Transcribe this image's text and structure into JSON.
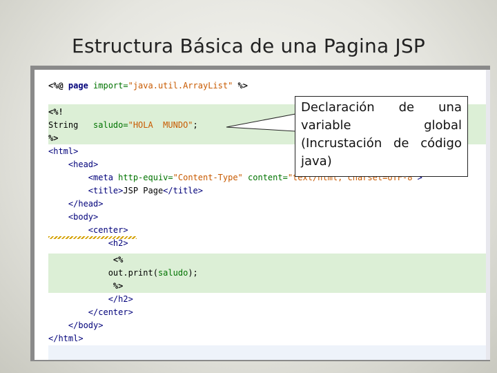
{
  "slide": {
    "title": "Estructura Básica de una Pagina JSP"
  },
  "code": {
    "lines": [
      [
        "<%@ ",
        "page",
        " import=",
        "\"java.util.ArrayList\"",
        " %>"
      ],
      [
        "<%!"
      ],
      [
        "String",
        "   saludo=",
        "\"HOLA  MUNDO\"",
        ";"
      ],
      [
        "%>"
      ],
      [
        "<html>"
      ],
      [
        "    <head>"
      ],
      [
        "        <meta ",
        "http-equiv=",
        "\"Content-Type\"",
        " content=",
        "\"text/html; charset=UTF-8\"",
        ">"
      ],
      [
        "        <title>",
        "JSP Page",
        "</title>"
      ],
      [
        "    </head>"
      ],
      [
        "    <body>"
      ],
      [
        "        <center>"
      ],
      [
        "            <h2>"
      ],
      [
        "             <%"
      ],
      [
        "            out.print(",
        "saludo",
        ");"
      ],
      [
        "             %>"
      ],
      [
        "            </h2>"
      ],
      [
        "        </center>"
      ],
      [
        "    </body>"
      ],
      [
        "</html>"
      ]
    ]
  },
  "callout": {
    "text": "Declaración de una variable global (Incrustación de código java)"
  },
  "colors": {
    "highlight": "#dcefd6",
    "tag": "#00007a",
    "attribute": "#007300",
    "string": "#c85a00"
  }
}
